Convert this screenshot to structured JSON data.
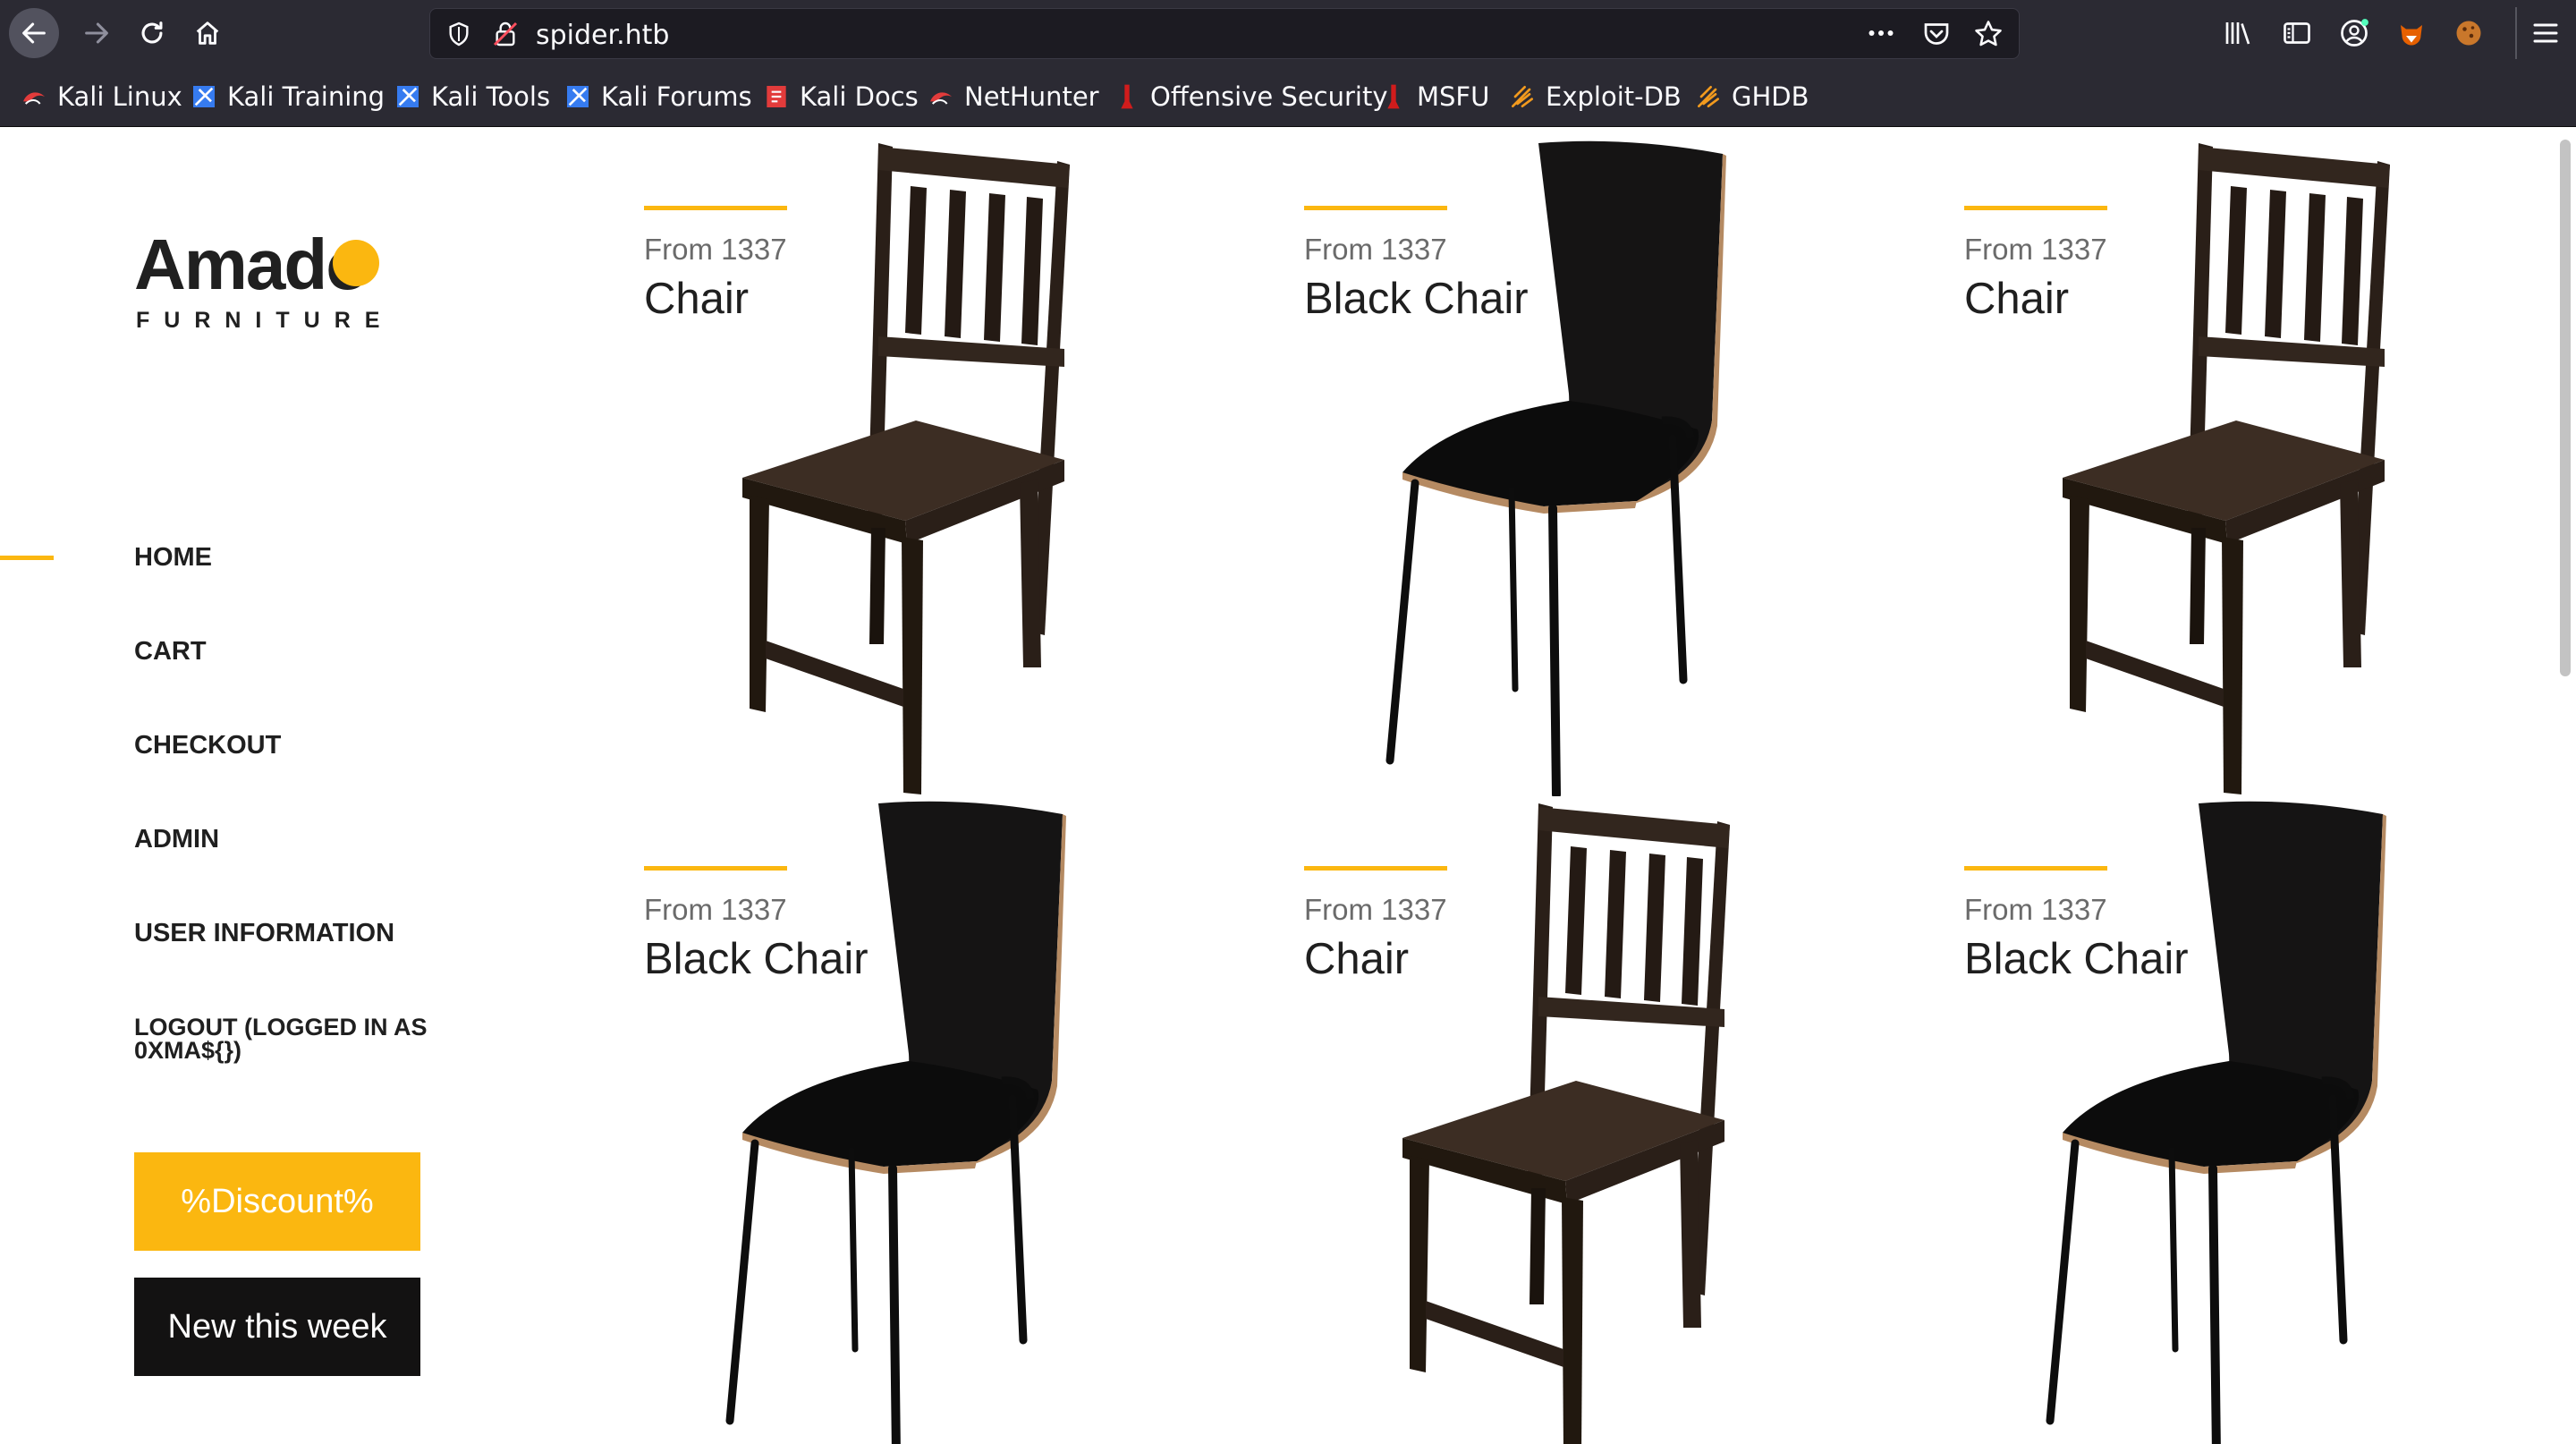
{
  "browser": {
    "url": "spider.htb",
    "bookmarks": [
      {
        "label": "Kali Linux",
        "icon": "kali-dragon-icon"
      },
      {
        "label": "Kali Training",
        "icon": "kali-training-icon"
      },
      {
        "label": "Kali Tools",
        "icon": "kali-tools-icon"
      },
      {
        "label": "Kali Forums",
        "icon": "kali-forums-icon"
      },
      {
        "label": "Kali Docs",
        "icon": "kali-docs-icon"
      },
      {
        "label": "NetHunter",
        "icon": "nethunter-icon"
      },
      {
        "label": "Offensive Security",
        "icon": "offsec-icon"
      },
      {
        "label": "MSFU",
        "icon": "msfu-icon"
      },
      {
        "label": "Exploit-DB",
        "icon": "exploit-db-icon"
      },
      {
        "label": "GHDB",
        "icon": "ghdb-icon"
      }
    ]
  },
  "site": {
    "logo_text": "Amado",
    "logo_sub": "FURNITURE",
    "accent_color": "#fbb710",
    "nav": [
      {
        "label": "HOME",
        "active": true
      },
      {
        "label": "CART",
        "active": false
      },
      {
        "label": "CHECKOUT",
        "active": false
      },
      {
        "label": "ADMIN",
        "active": false
      },
      {
        "label": "USER INFORMATION",
        "active": false
      },
      {
        "label": "LOGOUT (LOGGED IN AS 0XMA${})",
        "active": false
      }
    ],
    "discount_button": "%Discount%",
    "new_button": "New this week"
  },
  "products": [
    {
      "price": "From 1337",
      "name": "Chair",
      "image": "wooden-chair"
    },
    {
      "price": "From 1337",
      "name": "Black Chair",
      "image": "black-chair"
    },
    {
      "price": "From 1337",
      "name": "Chair",
      "image": "wooden-chair"
    },
    {
      "price": "From 1337",
      "name": "Black Chair",
      "image": "black-chair"
    },
    {
      "price": "From 1337",
      "name": "Chair",
      "image": "wooden-chair"
    },
    {
      "price": "From 1337",
      "name": "Black Chair",
      "image": "black-chair"
    }
  ]
}
